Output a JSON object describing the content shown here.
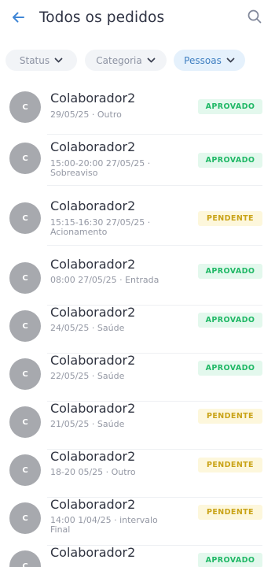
{
  "header": {
    "title": "Todos os pedidos",
    "back_icon": "arrow-left-icon",
    "search_icon": "search-icon",
    "accent_color": "#3f86d6"
  },
  "filters": [
    {
      "label": "Status",
      "active": false
    },
    {
      "label": "Categoria",
      "active": false
    },
    {
      "label": "Pessoas",
      "active": true
    }
  ],
  "requests": [
    {
      "avatar": "C",
      "name": "Colaborador2",
      "detail": "29/05/25 · Outro",
      "status": "APROVADO"
    },
    {
      "avatar": "C",
      "name": "Colaborador2",
      "detail": "15:00-20:00 27/05/25 · Sobreaviso",
      "status": "APROVADO"
    },
    {
      "avatar": "C",
      "name": "Colaborador2",
      "detail": "15:15-16:30 27/05/25 · Acionamento",
      "status": "PENDENTE"
    },
    {
      "avatar": "C",
      "name": "Colaborador2",
      "detail": "08:00 27/05/25 · Entrada",
      "status": "APROVADO"
    },
    {
      "avatar": "C",
      "name": "Colaborador2",
      "detail": "24/05/25 · Saúde",
      "status": "APROVADO"
    },
    {
      "avatar": "C",
      "name": "Colaborador2",
      "detail": "22/05/25 · Saúde",
      "status": "APROVADO"
    },
    {
      "avatar": "C",
      "name": "Colaborador2",
      "detail": "21/05/25 · Saúde",
      "status": "PENDENTE"
    },
    {
      "avatar": "C",
      "name": "Colaborador2",
      "detail": "18-20 05/25 · Outro",
      "status": "PENDENTE"
    },
    {
      "avatar": "C",
      "name": "Colaborador2",
      "detail": "14:00 1/04/25 · intervalo Final",
      "status": "PENDENTE"
    },
    {
      "avatar": "C",
      "name": "Colaborador2",
      "detail": "",
      "status": "APROVADO"
    }
  ],
  "status_colors": {
    "APROVADO": {
      "bg": "#e3f8ed",
      "fg": "#20b866"
    },
    "PENDENTE": {
      "bg": "#fdf7dc",
      "fg": "#c9a317"
    }
  }
}
